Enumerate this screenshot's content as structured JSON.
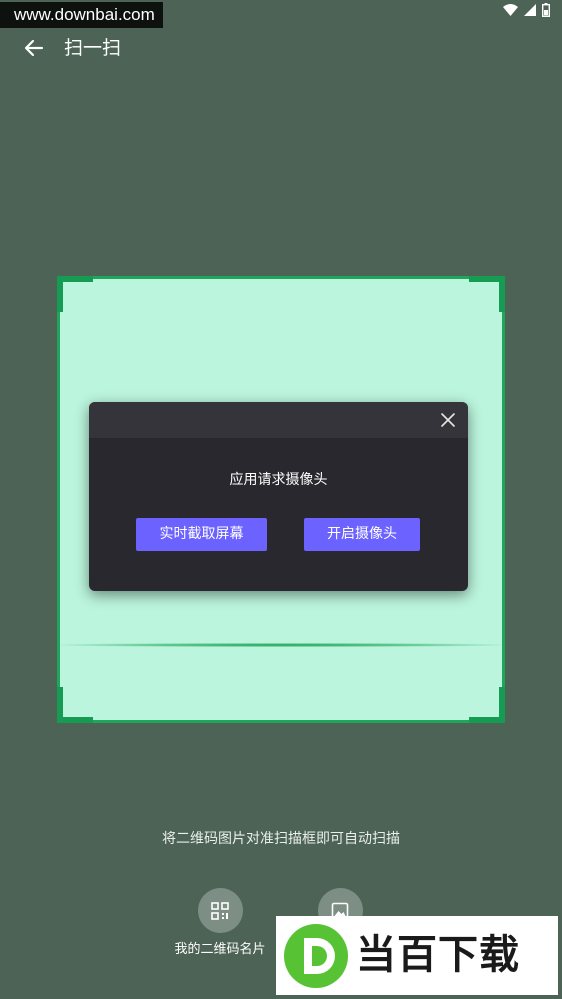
{
  "watermark": "www.downbai.com",
  "top_bar": {
    "title": "扫一扫"
  },
  "dialog": {
    "message": "应用请求摄像头",
    "btn_capture": "实时截取屏幕",
    "btn_camera": "开启摄像头"
  },
  "hint": "将二维码图片对准扫描框即可自动扫描",
  "actions": {
    "my_qr_label": "我的二维码名片"
  },
  "logo": {
    "text": "当百下载"
  },
  "colors": {
    "background": "#4c6356",
    "scan_frame_fill": "#bbf5dd",
    "scan_frame_border": "#1ea65c",
    "dialog_bg": "#2a282f",
    "button_accent": "#6c62ff",
    "logo_green": "#57c334"
  },
  "icons": {
    "back": "arrow-left-icon",
    "close": "close-icon",
    "qr": "qr-code-icon",
    "album": "image-icon",
    "wifi": "wifi-icon",
    "signal": "signal-icon",
    "battery": "battery-icon"
  }
}
